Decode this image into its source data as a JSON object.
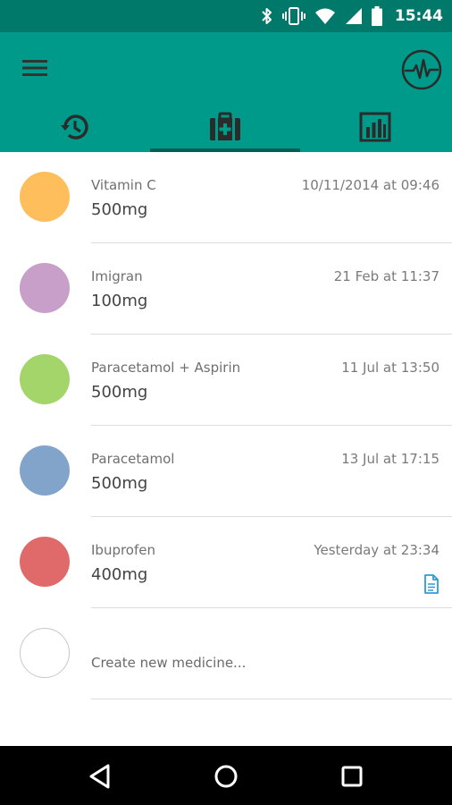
{
  "status_bar": {
    "time": "15:44",
    "icons": [
      "bluetooth-icon",
      "vibrate-icon",
      "wifi-icon",
      "signal-icon",
      "battery-icon"
    ],
    "background": "#00786a"
  },
  "app_bar": {
    "background": "#009a8a",
    "menu_icon": "menu-icon",
    "action_icon": "heart-rate-icon",
    "tabs": [
      {
        "icon": "history-icon",
        "selected": false
      },
      {
        "icon": "medical-kit-icon",
        "selected": true
      },
      {
        "icon": "bar-chart-icon",
        "selected": false
      }
    ],
    "indicator_color": "#005f55"
  },
  "medicines": [
    {
      "name": "Vitamin C",
      "dose": "500mg",
      "time": "10/11/2014 at 09:46",
      "color": "#ffbe5c",
      "has_note": false
    },
    {
      "name": "Imigran",
      "dose": "100mg",
      "time": "21 Feb at 11:37",
      "color": "#c79fc8",
      "has_note": false
    },
    {
      "name": "Paracetamol + Aspirin",
      "dose": "500mg",
      "time": "11 Jul at 13:50",
      "color": "#a3d56b",
      "has_note": false
    },
    {
      "name": "Paracetamol",
      "dose": "500mg",
      "time": "13 Jul at 17:15",
      "color": "#82a4cb",
      "has_note": false
    },
    {
      "name": "Ibuprofen",
      "dose": "400mg",
      "time": "Yesterday at 23:34",
      "color": "#e06a6a",
      "has_note": true,
      "note_icon": "note-icon",
      "note_color": "#2f9bd8"
    }
  ],
  "create_new": {
    "label": "Create new medicine..."
  },
  "nav_bar": {
    "buttons": [
      "back-icon",
      "home-icon",
      "recents-icon"
    ]
  }
}
